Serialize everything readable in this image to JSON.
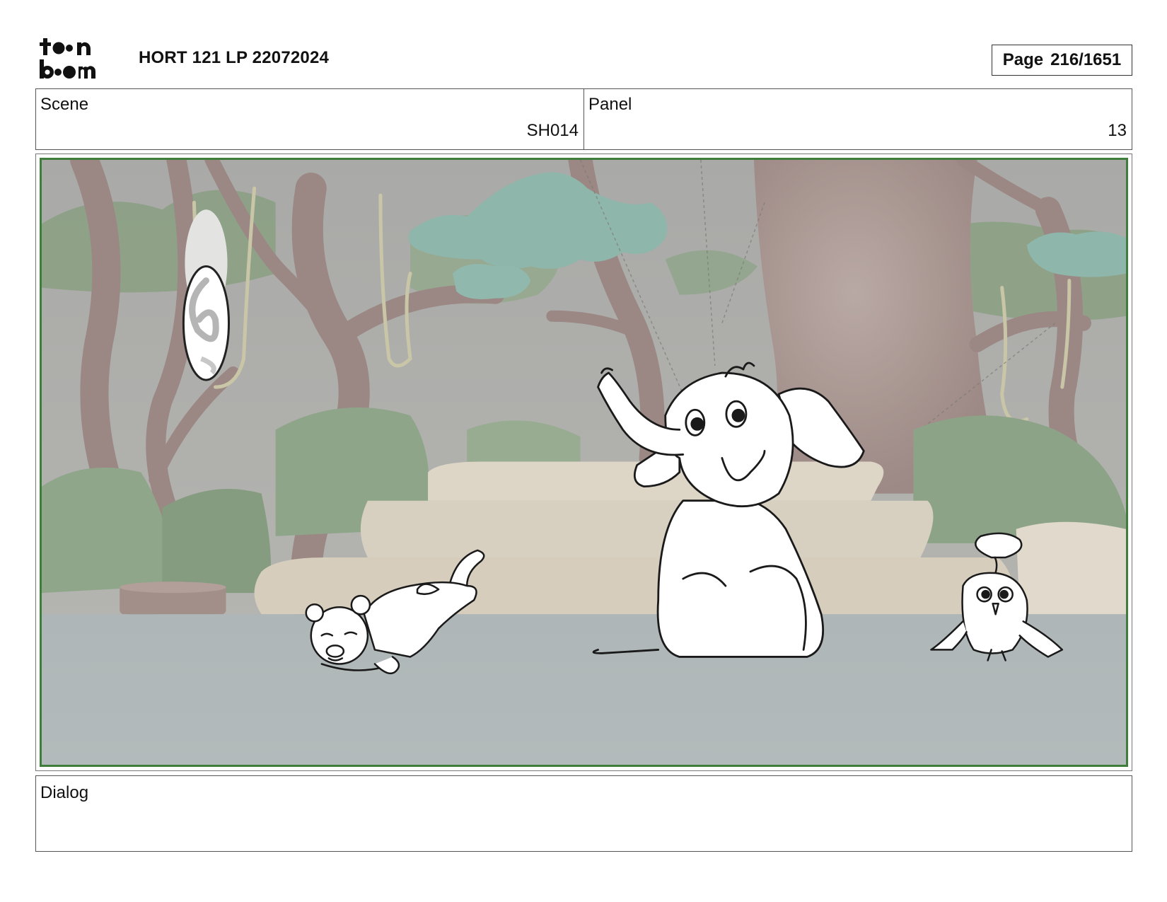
{
  "header": {
    "logo_text": "toonboom",
    "doc_title": "HORT 121 LP 22072024",
    "page_label": "Page",
    "page_value": "216/1651"
  },
  "info": {
    "scene_label": "Scene",
    "scene_value": "SH014",
    "panel_label": "Panel",
    "panel_value": "13"
  },
  "dialog": {
    "label": "Dialog",
    "text": ""
  },
  "frame": {
    "border_color": "#3f7d3a",
    "background": "jungle clearing with trees, hanging vines, rock steps and a hanging cocoon",
    "characters": [
      "lion-cub-sketch",
      "elephant-calf-sketch",
      "bird-chick-sketch"
    ]
  }
}
